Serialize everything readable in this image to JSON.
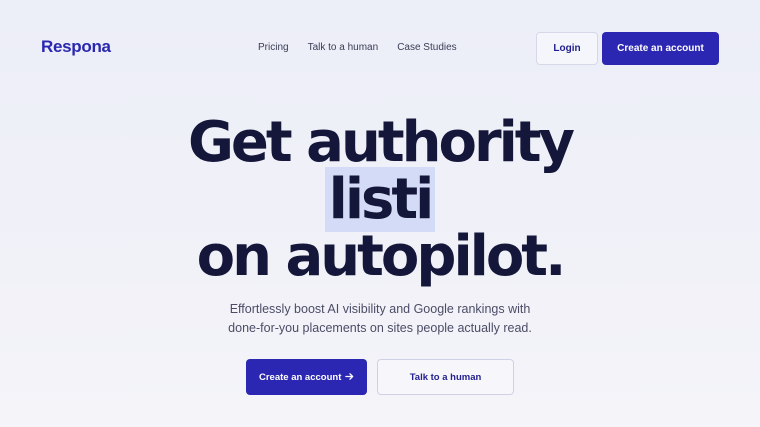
{
  "brand": {
    "name": "Respona"
  },
  "nav": {
    "links": [
      "Pricing",
      "Talk to a human",
      "Case Studies"
    ],
    "login": "Login",
    "create_account": "Create an account"
  },
  "hero": {
    "line1": "Get authority",
    "line2": "listi",
    "line3": "on autopilot.",
    "subtitle_line1": "Effortlessly boost AI visibility and Google rankings with",
    "subtitle_line2": "done-for-you placements on sites people actually read.",
    "cta_primary": "Create an account",
    "cta_secondary": "Talk to a human"
  },
  "icons": {
    "cta_arrow": "arrow-right-icon"
  },
  "colors": {
    "accent": "#2b27b3",
    "heading": "#14163a",
    "highlight": "#d4dbf6",
    "background": "#eef0f8"
  }
}
